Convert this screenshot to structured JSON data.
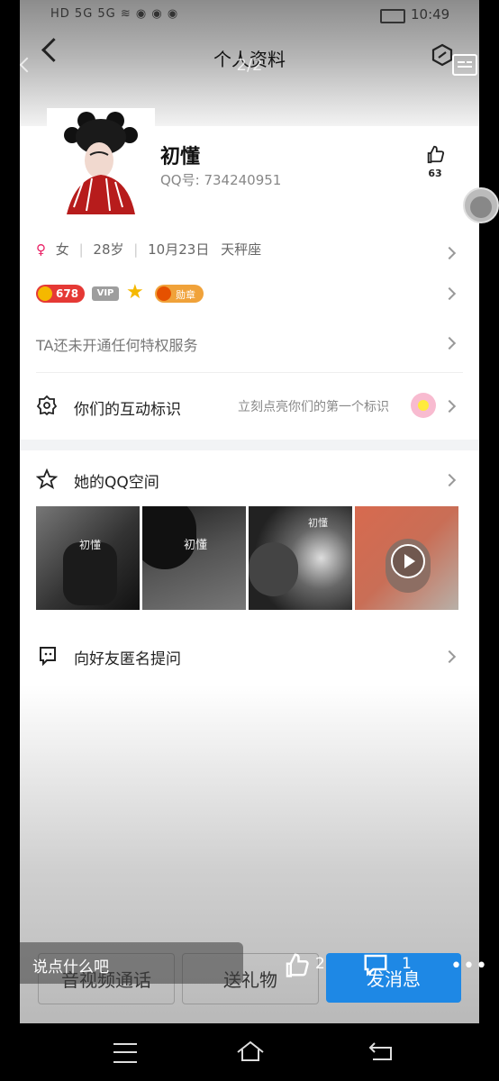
{
  "status_bar": {
    "time": "10:49"
  },
  "nav": {
    "title": "个人资料",
    "page_indicator": "2/2"
  },
  "profile": {
    "name": "初懂",
    "qq_label": "QQ号:",
    "qq_number": "734240951",
    "likes": "63"
  },
  "info": {
    "gender": "女",
    "age": "28岁",
    "birthday": "10月23日",
    "zodiac": "天秤座"
  },
  "badges": {
    "level": "678",
    "vip": "VIP",
    "medal": "勋章"
  },
  "privilege": {
    "text": "TA还未开通任何特权服务"
  },
  "interaction": {
    "label": "你们的互动标识",
    "hint": "立刻点亮你们的第一个标识"
  },
  "qzone": {
    "label": "她的QQ空间",
    "photos": [
      {
        "caption": "初懂"
      },
      {
        "caption": "初懂"
      },
      {
        "caption": "初懂"
      },
      {
        "caption": ""
      }
    ]
  },
  "anon": {
    "label": "向好友匿名提问"
  },
  "buttons": {
    "call": "音视频通话",
    "gift": "送礼物",
    "message": "发消息"
  },
  "comment_bar": {
    "placeholder": "说点什么吧",
    "like_count": "2",
    "comment_count": "1"
  },
  "colors": {
    "accent": "#1e88e5",
    "level_badge": "#e53935",
    "gold": "#f5b800"
  }
}
